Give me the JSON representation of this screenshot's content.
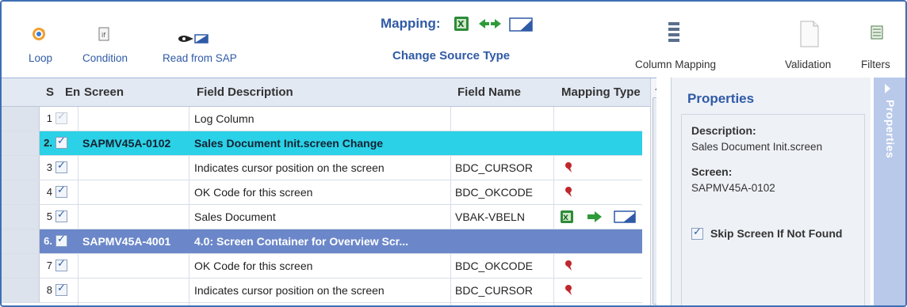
{
  "toolbar": {
    "loop_label": "Loop",
    "condition_label": "Condition",
    "read_sap_label": "Read from SAP",
    "mapping_label": "Mapping:",
    "change_source_label": "Change Source Type",
    "column_mapping_label": "Column Mapping",
    "validation_label": "Validation",
    "filters_label": "Filters"
  },
  "grid": {
    "headers": {
      "s": "S",
      "en": "En",
      "screen": "Screen",
      "field_description": "Field Description",
      "field_name": "Field Name",
      "mapping_type": "Mapping Type"
    },
    "rows": [
      {
        "num": "1",
        "enabled": true,
        "disabled_check": true,
        "screen": "",
        "description": "Log Column",
        "field_name": "",
        "mapping": ""
      },
      {
        "num": "2.",
        "enabled": true,
        "screen": "SAPMV45A-0102",
        "description": "Sales Document      Init.screen  Change",
        "field_name": "",
        "mapping": "",
        "highlight": "cyan"
      },
      {
        "num": "3",
        "enabled": true,
        "screen": "",
        "description": "Indicates cursor position on the screen",
        "field_name": "BDC_CURSOR",
        "mapping": "pin"
      },
      {
        "num": "4",
        "enabled": true,
        "screen": "",
        "description": "OK Code for this screen",
        "field_name": "BDC_OKCODE",
        "mapping": "pin"
      },
      {
        "num": "5",
        "enabled": true,
        "screen": "",
        "description": "Sales Document",
        "field_name": "VBAK-VBELN",
        "mapping": "excel-arrow-field"
      },
      {
        "num": "6.",
        "enabled": true,
        "screen": "SAPMV45A-4001",
        "description": "4.0: Screen Container for Overview Scr...",
        "field_name": "",
        "mapping": "",
        "highlight": "blue"
      },
      {
        "num": "7",
        "enabled": true,
        "screen": "",
        "description": "OK Code for this screen",
        "field_name": "BDC_OKCODE",
        "mapping": "pin"
      },
      {
        "num": "8",
        "enabled": true,
        "screen": "",
        "description": "Indicates cursor position on the screen",
        "field_name": "BDC_CURSOR",
        "mapping": "pin"
      }
    ]
  },
  "properties": {
    "title": "Properties",
    "description_label": "Description:",
    "description_value": "Sales Document      Init.screen",
    "screen_label": "Screen:",
    "screen_value": "SAPMV45A-0102",
    "skip_label": "Skip Screen If Not Found",
    "tab_label": "Properties"
  },
  "colors": {
    "accent": "#2f5aa6",
    "row_highlight_cyan": "#2bd1e6",
    "row_highlight_blue": "#6b87c9"
  }
}
